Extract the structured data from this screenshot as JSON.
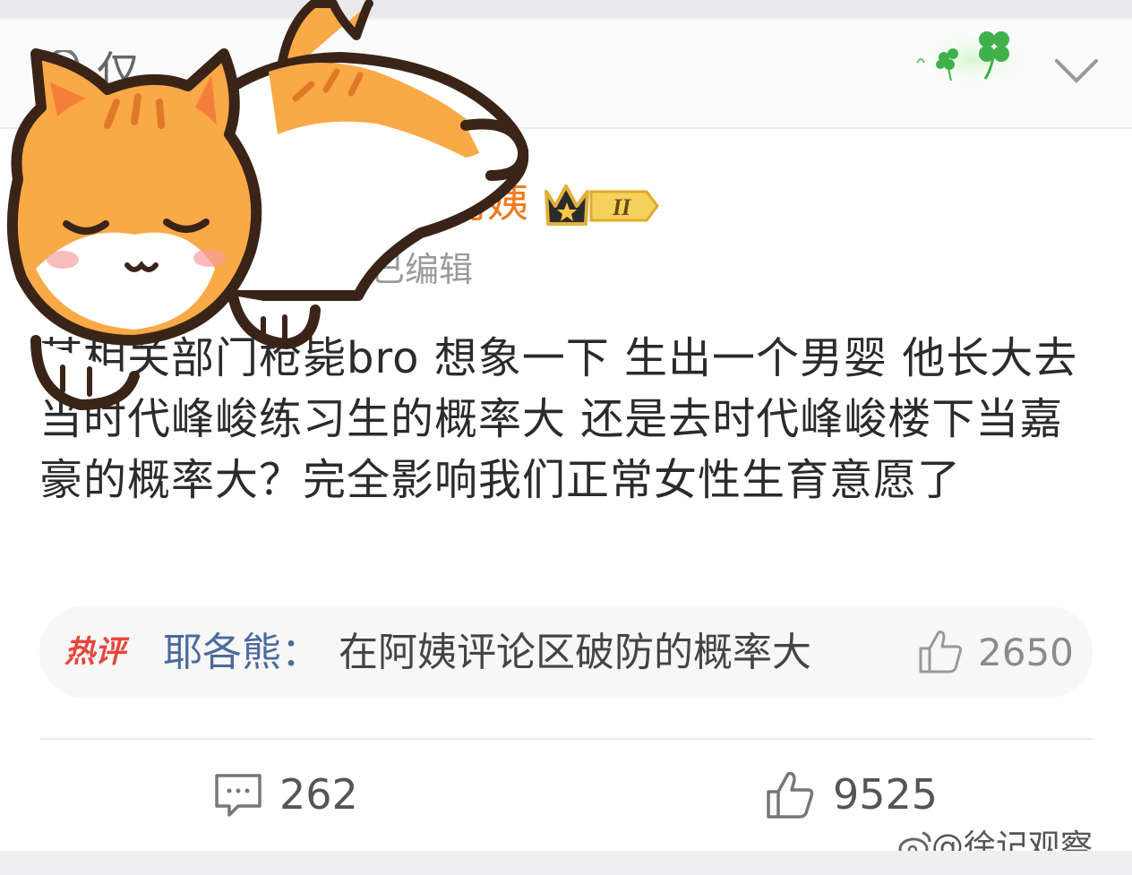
{
  "visibility": {
    "label": "仅"
  },
  "comment": {
    "author_visible": "阿姨",
    "badge_level": "II",
    "edited_label": "已编辑",
    "text": "某相关部门枪毙bro 想象一下 生出一个男婴 他长大去当时代峰峻练习生的概率大 还是去时代峰峻楼下当嘉豪的概率大？完全影响我们正常女性生育意愿了",
    "reply_count": "262",
    "like_count": "9525"
  },
  "hot_reply": {
    "tag": "热评",
    "user": "耶各熊：",
    "text": "在阿姨评论区破防的概率大",
    "like_count": "2650"
  },
  "watermark": {
    "text": "@徐记观察"
  },
  "icons": {
    "privacy": "lock-heart-icon",
    "expand": "chevron-down-icon",
    "decoration": "clover-icon",
    "crown": "crown-badge-icon",
    "reply": "comment-icon",
    "like": "thumbs-up-icon",
    "watermark": "weibo-icon",
    "sticker": "sleeping-cat-sticker"
  },
  "colors": {
    "username": "#f07a1c",
    "hot_user": "#4c6a9b",
    "hot_tag": "#e8463c",
    "clover": "#3fb04a"
  }
}
